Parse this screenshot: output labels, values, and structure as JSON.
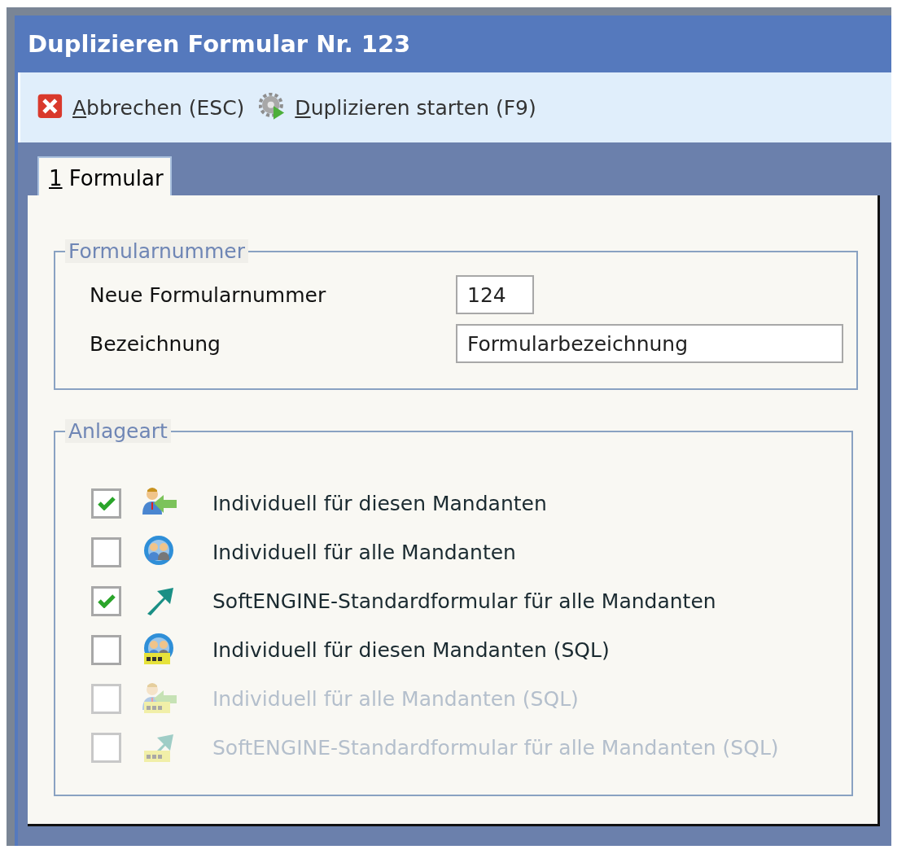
{
  "window": {
    "title": "Duplizieren Formular Nr. 123"
  },
  "toolbar": {
    "buttons": [
      {
        "label": "Abbrechen (ESC)",
        "kind": "cancel"
      },
      {
        "label": "Duplizieren starten (F9)",
        "kind": "start"
      }
    ]
  },
  "tabs": [
    {
      "label": "1 Formular",
      "selected": true
    }
  ],
  "formularnummer": {
    "legend": "Formularnummer",
    "fields": [
      {
        "label": "Neue Formularnummer",
        "value": "124",
        "kind": "short"
      },
      {
        "label": "Bezeichnung",
        "value": "Formularbezeichnung",
        "kind": "wide"
      }
    ]
  },
  "anlageart": {
    "legend": "Anlageart",
    "options": [
      {
        "label": "Individuell für diesen Mandanten",
        "checked": true,
        "disabled": false,
        "kind": "person-arrow"
      },
      {
        "label": "Individuell für alle Mandanten",
        "checked": false,
        "disabled": false,
        "kind": "people-cycle"
      },
      {
        "label": "SoftENGINE-Standardformular für alle Mandanten",
        "checked": true,
        "disabled": false,
        "kind": "arrow"
      },
      {
        "label": "Individuell für diesen Mandanten (SQL)",
        "checked": false,
        "disabled": false,
        "kind": "people-sql"
      },
      {
        "label": "Individuell für alle Mandanten (SQL)",
        "checked": false,
        "disabled": true,
        "kind": "person-sql"
      },
      {
        "label": "SoftENGINE-Standardformular für alle Mandanten (SQL)",
        "checked": false,
        "disabled": true,
        "kind": "arrow-sql"
      }
    ]
  }
}
